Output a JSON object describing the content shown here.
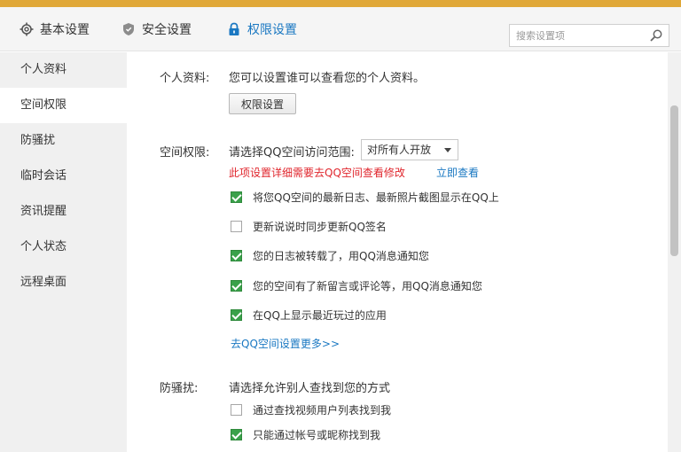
{
  "tabs": [
    {
      "label": "基本设置",
      "icon": "gear-icon",
      "active": false
    },
    {
      "label": "安全设置",
      "icon": "shield-icon",
      "active": false
    },
    {
      "label": "权限设置",
      "icon": "lock-icon",
      "active": true
    }
  ],
  "search": {
    "placeholder": "搜索设置项"
  },
  "sidebar": {
    "items": [
      {
        "label": "个人资料"
      },
      {
        "label": "空间权限"
      },
      {
        "label": "防骚扰"
      },
      {
        "label": "临时会话"
      },
      {
        "label": "showTips",
        "display": "资讯提醒"
      },
      {
        "label": "个人状态"
      },
      {
        "label": "远程桌面"
      }
    ]
  },
  "profile": {
    "label": "个人资料:",
    "desc": "您可以设置谁可以查看您的个人资料。",
    "button": "权限设置"
  },
  "space": {
    "label": "空间权限:",
    "prompt": "请选择QQ空间访问范围:",
    "select_value": "对所有人开放",
    "warning": "此项设置详细需要去QQ空间查看修改",
    "warning_link": "立即查看",
    "options": [
      {
        "text": "将您QQ空间的最新日志、最新照片截图显示在QQ上",
        "checked": true
      },
      {
        "text": "更新说说时同步更新QQ签名",
        "checked": false
      },
      {
        "text": "您的日志被转载了，用QQ消息通知您",
        "checked": true
      },
      {
        "text": "您的空间有了新留言或评论等，用QQ消息通知您",
        "checked": true
      },
      {
        "text": "在QQ上显示最近玩过的应用",
        "checked": true
      }
    ],
    "more_link": "去QQ空间设置更多>>"
  },
  "harass": {
    "label": "防骚扰:",
    "prompt": "请选择允许别人查找到您的方式",
    "options": [
      {
        "text": "通过查找视频用户列表找到我",
        "checked": false
      },
      {
        "text": "只能通过帐号或昵称找到我",
        "checked": true
      }
    ]
  },
  "colors": {
    "accent": "#1a78c2",
    "warning": "#e0262d",
    "check": "#3aa14a",
    "topbar": "#e0a838"
  }
}
